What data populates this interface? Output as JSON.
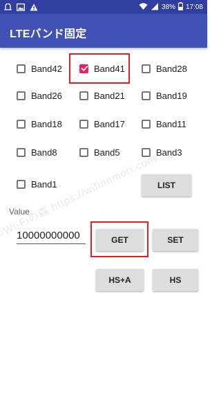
{
  "status_bar": {
    "battery": "38%",
    "time": "17:08",
    "left_icons": [
      "notification-icon",
      "image-icon",
      "warning-icon"
    ],
    "right_icons": [
      "wifi-icon",
      "signal-icon",
      "battery-icon"
    ]
  },
  "app_bar": {
    "title": "LTEバンド固定"
  },
  "bands": [
    {
      "label": "Band42",
      "checked": false
    },
    {
      "label": "Band41",
      "checked": true
    },
    {
      "label": "Band28",
      "checked": false
    },
    {
      "label": "Band26",
      "checked": false
    },
    {
      "label": "Band21",
      "checked": false
    },
    {
      "label": "Band19",
      "checked": false
    },
    {
      "label": "Band18",
      "checked": false
    },
    {
      "label": "Band17",
      "checked": false
    },
    {
      "label": "Band11",
      "checked": false
    },
    {
      "label": "Band8",
      "checked": false
    },
    {
      "label": "Band5",
      "checked": false
    },
    {
      "label": "Band3",
      "checked": false
    },
    {
      "label": "Band1",
      "checked": false
    }
  ],
  "buttons": {
    "list": "LIST",
    "get": "GET",
    "set": "SET",
    "hs_a": "HS+A",
    "hs": "HS"
  },
  "value": {
    "label": "Value",
    "input_value": "10000000000"
  },
  "watermark": "©Wi-Fiの森 https://wifinomori.com",
  "colors": {
    "status_bar": "#303f9f",
    "app_bar": "#3f51b5",
    "checkbox_checked": "#e91e63",
    "highlight": "#e02020"
  }
}
